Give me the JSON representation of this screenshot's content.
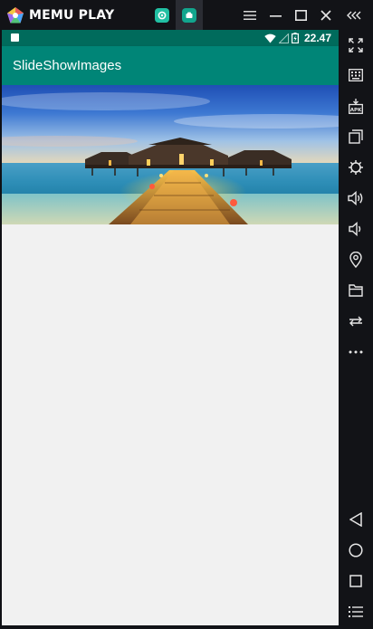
{
  "emulator": {
    "brand": "MEMU PLAY",
    "tabs": [
      {
        "icon": "memu-home-icon"
      },
      {
        "icon": "android-app-icon",
        "active": true
      }
    ],
    "window_controls": [
      "menu-icon",
      "minimize-icon",
      "maximize-icon",
      "close-icon",
      "collapse-sidebar-icon"
    ],
    "sidebar_tools": [
      "fullscreen-icon",
      "keyboard-mapping-icon",
      "install-apk-icon",
      "multi-window-icon",
      "settings-icon",
      "volume-up-icon",
      "volume-down-icon",
      "location-icon",
      "shared-folder-icon",
      "rotate-icon",
      "more-icon"
    ],
    "nav_buttons": [
      "back-icon",
      "home-icon",
      "recent-apps-icon",
      "menu-list-icon"
    ]
  },
  "android": {
    "status_bar": {
      "time": "22.47",
      "icons": [
        "wifi-icon",
        "signal-icon",
        "battery-icon"
      ]
    },
    "app_bar": {
      "title": "SlideShowImages"
    },
    "slideshow": {
      "image": "overwater-villa-pier-sunset"
    }
  },
  "colors": {
    "status_bar": "#006b5c",
    "app_bar": "#008577",
    "content_bg": "#f1f1f1",
    "emulator_chrome": "#121317"
  }
}
